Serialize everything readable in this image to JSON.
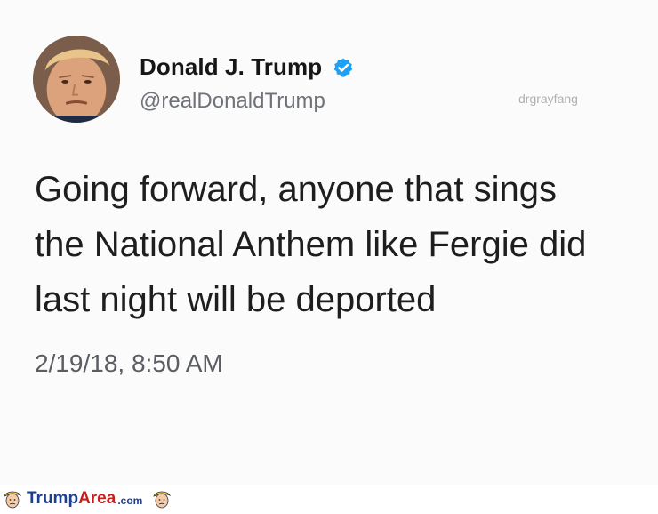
{
  "tweet": {
    "display_name": "Donald J. Trump",
    "handle": "@realDonaldTrump",
    "watermark": "drgrayfang",
    "lines": [
      "Going forward, anyone that sings",
      "the National Anthem like Fergie did",
      "last night will be deported"
    ],
    "timestamp": "2/19/18, 8:50 AM",
    "verified_color": "#1da1f2"
  },
  "footer": {
    "brand_part1": "Trump",
    "brand_part2": "Area",
    "brand_suffix": ".com",
    "brand_color_blue": "#1d3f8f",
    "brand_color_red": "#c42020"
  }
}
